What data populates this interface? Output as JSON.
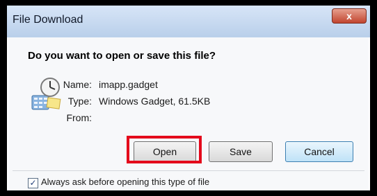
{
  "window": {
    "title": "File Download",
    "close_glyph": "x"
  },
  "dialog": {
    "prompt": "Do you want to open or save this file?",
    "file_icon": "gadget-file-icon",
    "name_label": "Name:",
    "name_value": "imapp.gadget",
    "type_label": "Type:",
    "type_value": "Windows Gadget, 61.5KB",
    "from_label": "From:",
    "from_value": ""
  },
  "buttons": {
    "open": "Open",
    "save": "Save",
    "cancel": "Cancel"
  },
  "checkbox": {
    "checked": true,
    "check_glyph": "✓",
    "label": "Always ask before opening this type of file"
  },
  "colors": {
    "highlight": "#e4091b"
  }
}
